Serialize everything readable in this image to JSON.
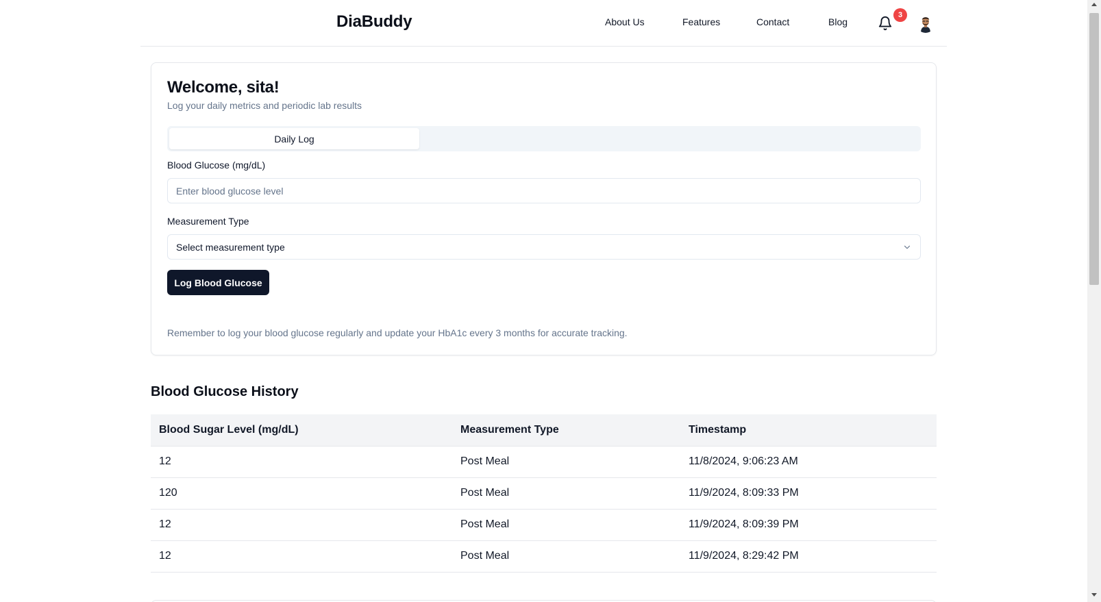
{
  "header": {
    "brand": "DiaBuddy",
    "nav": [
      "About Us",
      "Features",
      "Contact",
      "Blog"
    ],
    "notification_count": "3"
  },
  "card": {
    "welcome": "Welcome, sita!",
    "subtitle": "Log your daily metrics and periodic lab results",
    "tabs": [
      {
        "label": "Daily Log",
        "active": true
      }
    ],
    "glucose_label": "Blood Glucose (mg/dL)",
    "glucose_placeholder": "Enter blood glucose level",
    "type_label": "Measurement Type",
    "type_value": "Select measurement type",
    "button": "Log Blood Glucose",
    "reminder": "Remember to log your blood glucose regularly and update your HbA1c every 3 months for accurate tracking."
  },
  "history": {
    "title": "Blood Glucose History",
    "columns": [
      "Blood Sugar Level (mg/dL)",
      "Measurement Type",
      "Timestamp"
    ],
    "rows": [
      [
        "12",
        "Post Meal",
        "11/8/2024, 9:06:23 AM"
      ],
      [
        "120",
        "Post Meal",
        "11/9/2024, 8:09:33 PM"
      ],
      [
        "12",
        "Post Meal",
        "11/9/2024, 8:09:39 PM"
      ],
      [
        "12",
        "Post Meal",
        "11/9/2024, 8:29:42 PM"
      ]
    ]
  },
  "icons": {
    "bell": "bell-icon",
    "chevron": "chevron-down-icon",
    "avatar": "avatar"
  },
  "colors": {
    "primary": "#0f172a",
    "badge": "#ef4444",
    "muted": "#64748b"
  }
}
